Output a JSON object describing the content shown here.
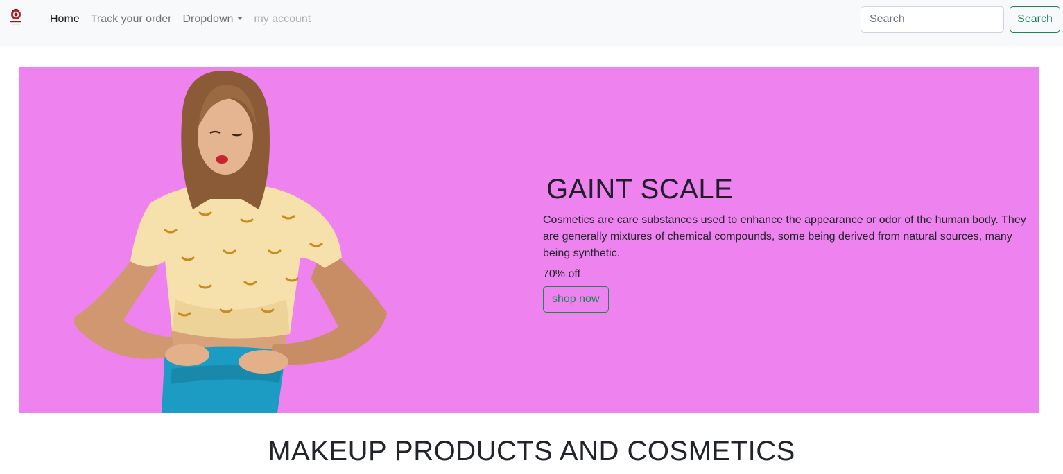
{
  "navbar": {
    "brand": {
      "icon": "beauty-logo-icon",
      "logo_text": "BEAUTY"
    },
    "links": [
      {
        "label": "Home",
        "state": "active"
      },
      {
        "label": "Track your order",
        "state": "normal"
      },
      {
        "label": "Dropdown",
        "state": "normal",
        "has_caret": true
      },
      {
        "label": "my account",
        "state": "disabled"
      }
    ],
    "search": {
      "placeholder": "Search",
      "value": "",
      "button_label": "Search"
    }
  },
  "hero": {
    "background_color": "#ee82ee",
    "image": "woman-winking-banana-tshirt",
    "title": "GAINT SCALE",
    "description": "Cosmetics are care substances used to enhance the appearance or odor of the human body. They are generally mixtures of chemical compounds, some being derived from natural sources, many being synthetic.",
    "discount": "70% off",
    "button_label": "shop now"
  },
  "section": {
    "heading": "MAKEUP PRODUCTS AND COSMETICS"
  },
  "colors": {
    "navbar_bg": "#f8f9fa",
    "accent": "#198754",
    "hero_bg": "#ee82ee"
  }
}
